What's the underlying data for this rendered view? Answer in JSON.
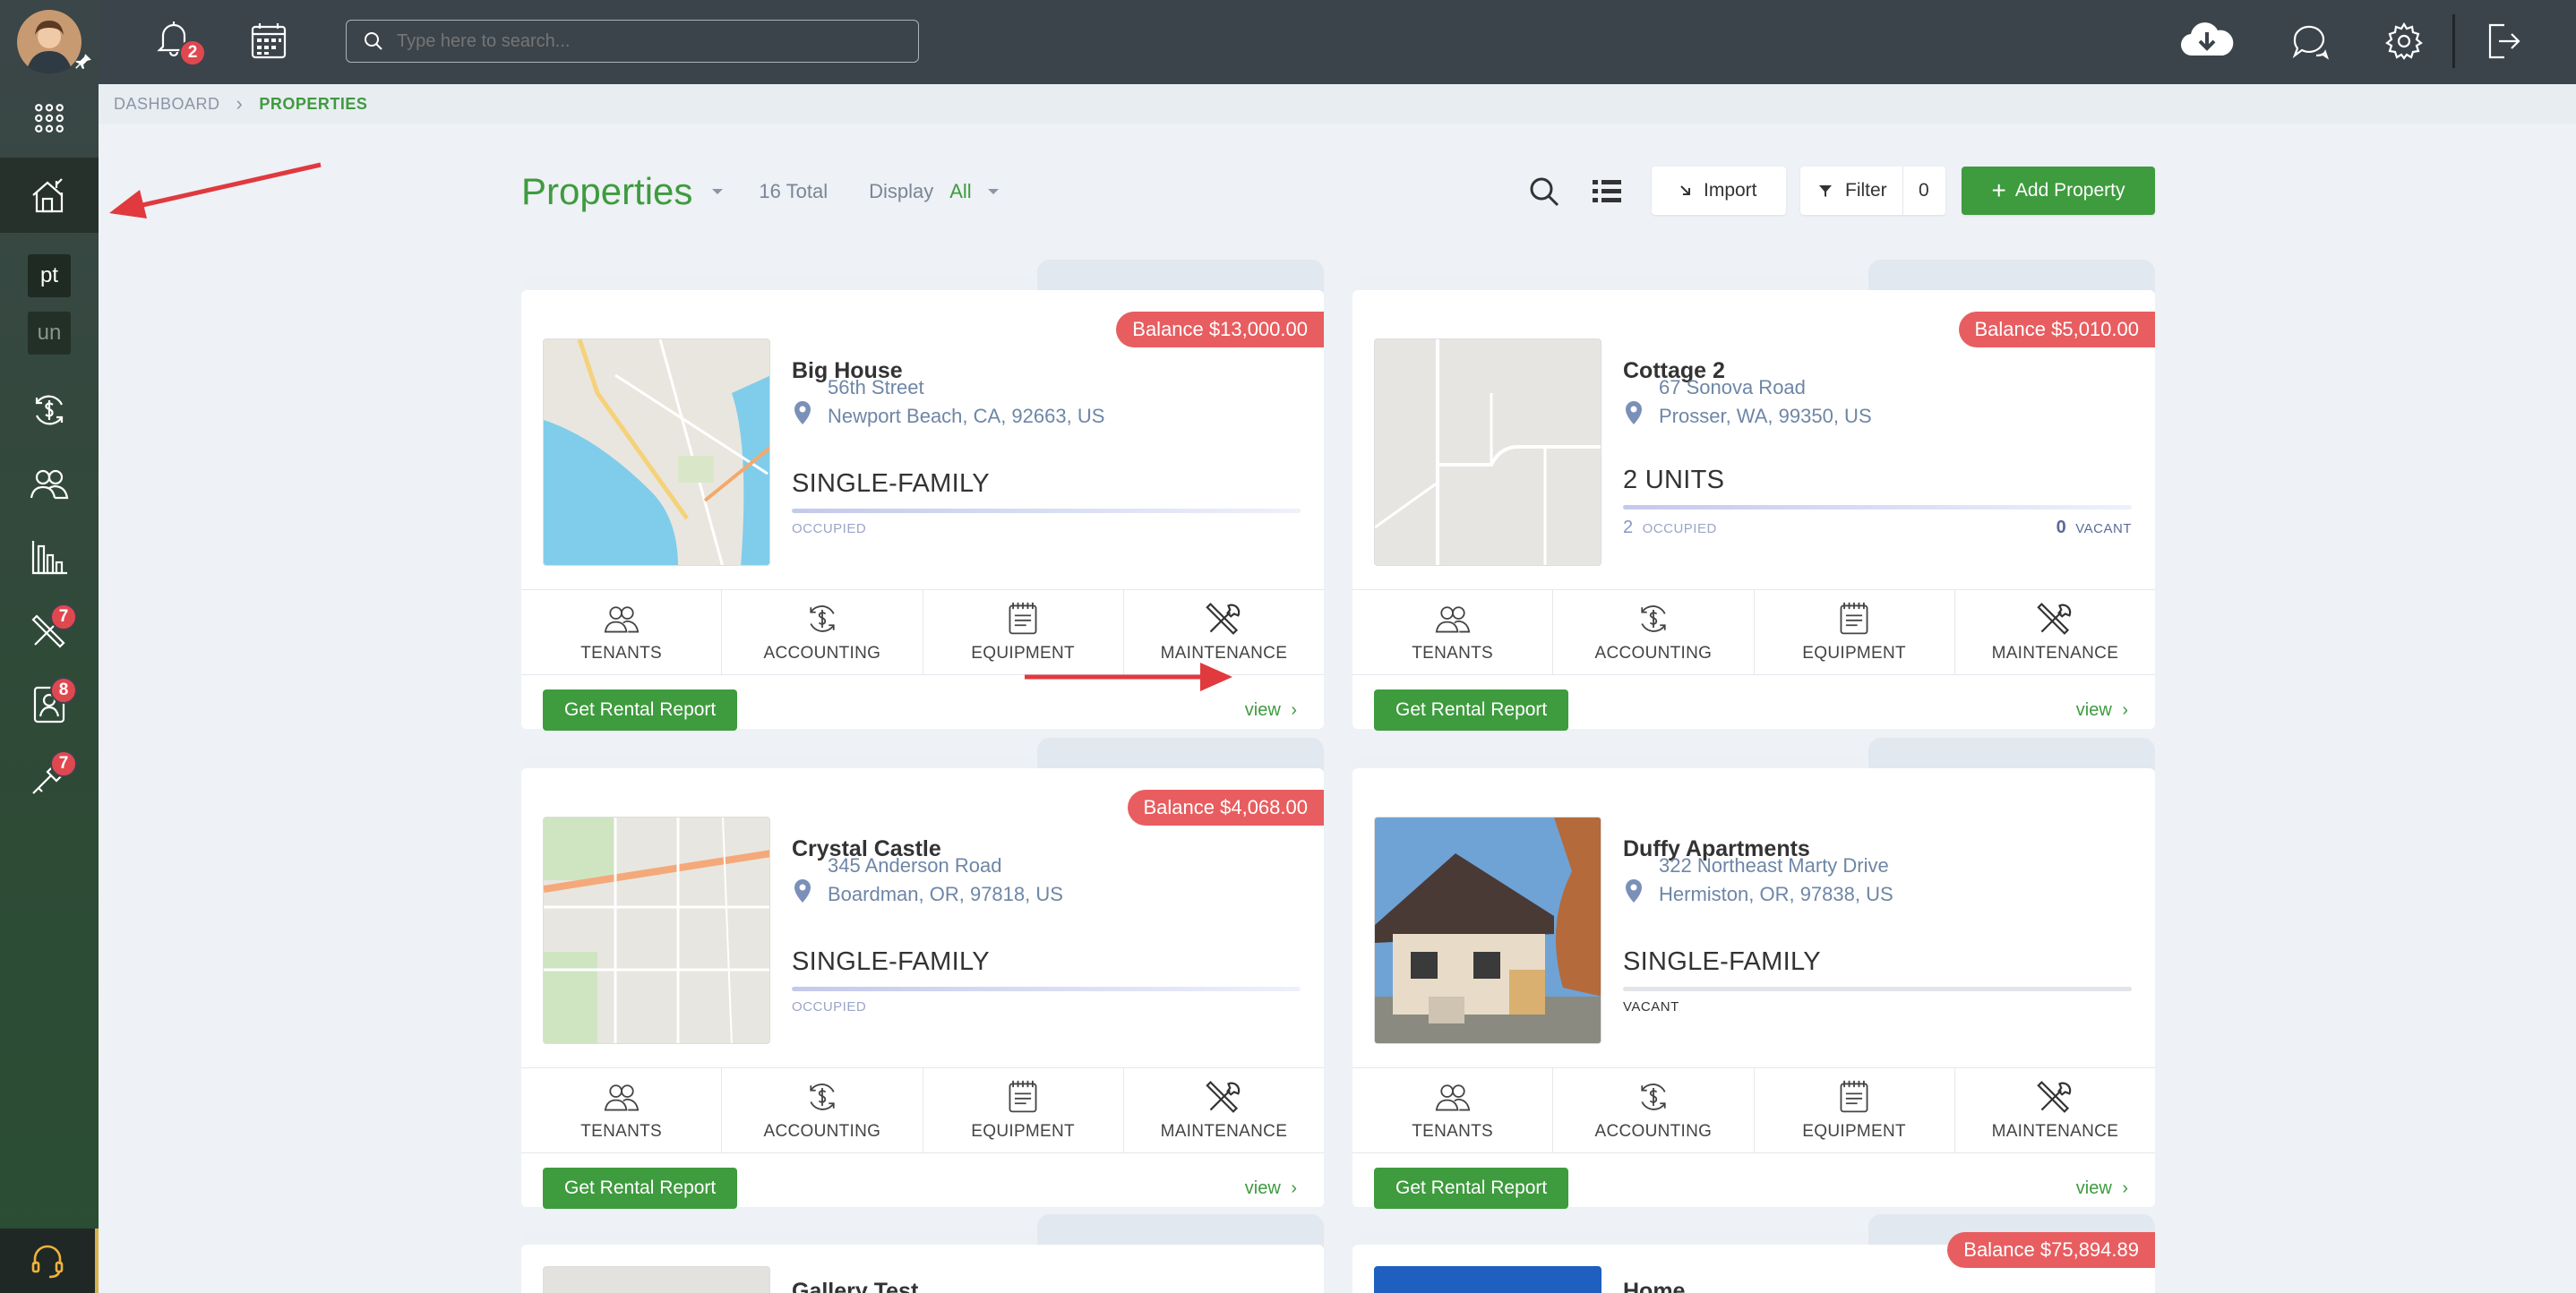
{
  "topbar": {
    "notifications_count": "2",
    "search": {
      "placeholder": "Type here to search..."
    }
  },
  "sidebar": {
    "badges": {
      "maintenance": "7",
      "contacts": "8",
      "tools": "7"
    },
    "text_items": {
      "pt": "pt",
      "un": "un"
    }
  },
  "breadcrumb": {
    "home": "DASHBOARD",
    "separator": "›",
    "current": "PROPERTIES"
  },
  "header": {
    "title": "Properties",
    "total": "16 Total",
    "display_label": "Display",
    "display_value": "All",
    "import_label": "Import",
    "filter_label": "Filter",
    "filter_count": "0",
    "add_label": "Add Property"
  },
  "card_labels": {
    "tenants": "TENANTS",
    "accounting": "ACCOUNTING",
    "equipment": "EQUIPMENT",
    "maintenance": "MAINTENANCE",
    "report": "Get Rental Report",
    "view": "view"
  },
  "properties": [
    {
      "name": "Big House",
      "street": "56th Street",
      "city": "Newport Beach, CA, 92663, US",
      "type": "SINGLE-FAMILY",
      "status": "OCCUPIED",
      "balance": "Balance $13,000.00"
    },
    {
      "name": "Cottage 2",
      "street": "67 Sonova Road",
      "city": "Prosser, WA, 99350, US",
      "type": "2 UNITS",
      "occupied_count": "2",
      "occupied_label": "OCCUPIED",
      "vacant_count": "0",
      "vacant_label": "VACANT",
      "balance": "Balance $5,010.00"
    },
    {
      "name": "Crystal Castle",
      "street": "345 Anderson Road",
      "city": "Boardman, OR, 97818, US",
      "type": "SINGLE-FAMILY",
      "status": "OCCUPIED",
      "balance": "Balance $4,068.00"
    },
    {
      "name": "Duffy Apartments",
      "street": "322 Northeast Marty Drive",
      "city": "Hermiston, OR, 97838, US",
      "type": "SINGLE-FAMILY",
      "status": "VACANT",
      "balance": ""
    },
    {
      "name": "Gallery Test",
      "balance": ""
    },
    {
      "name": "Home",
      "balance": "Balance $75,894.89"
    }
  ],
  "colors": {
    "accent": "#3e9b3e",
    "balance": "#e85d60",
    "sidebar": "#2f4a37",
    "topbar": "#3b444b"
  }
}
